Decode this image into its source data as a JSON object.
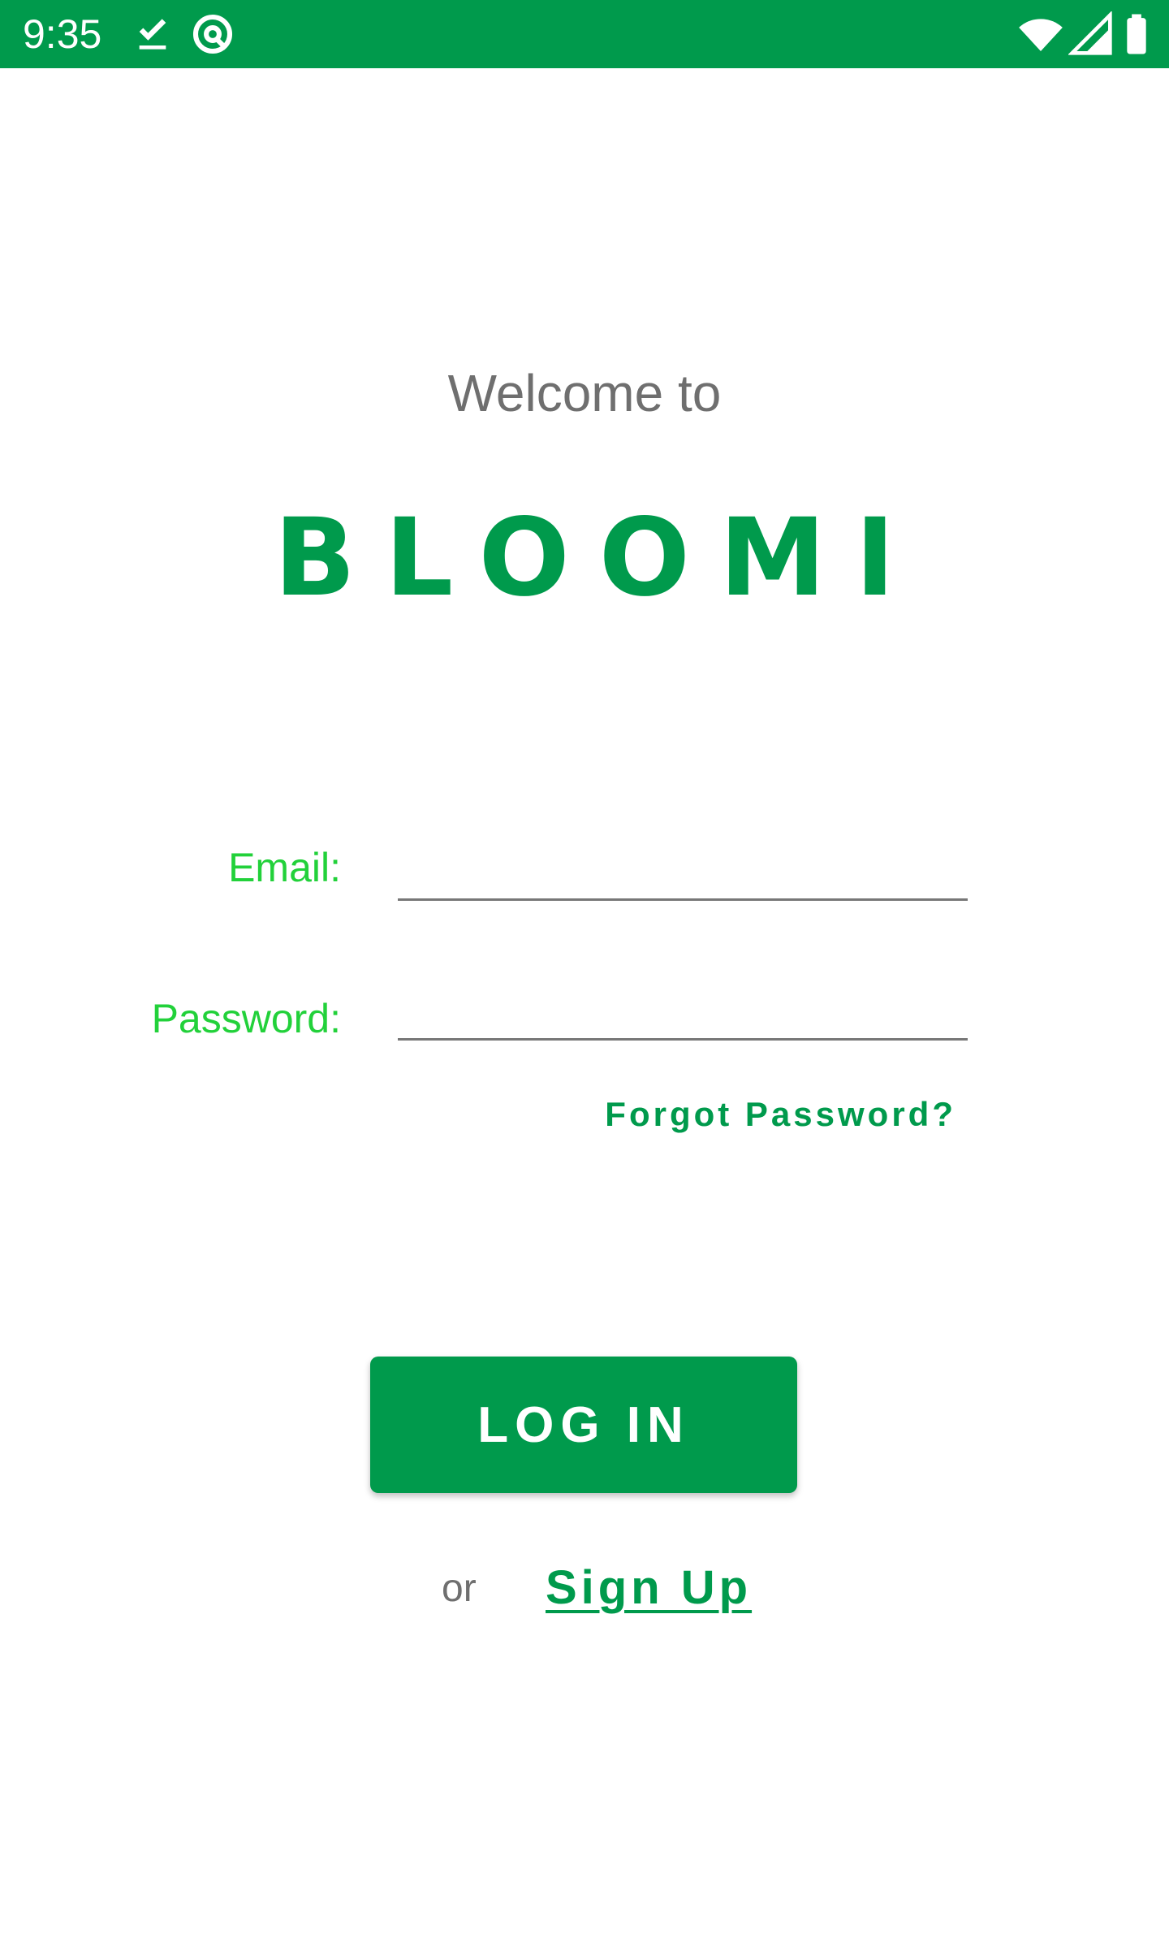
{
  "status_bar": {
    "time": "9:35",
    "icons": [
      "download-done-icon",
      "at-sign-icon",
      "wifi-icon",
      "cellular-signal-icon",
      "battery-icon"
    ],
    "background_color": "#009a4c"
  },
  "welcome": {
    "text": "Welcome to"
  },
  "brand": {
    "name": "BLOOMI",
    "color": "#009a4c"
  },
  "form": {
    "email_label": "Email:",
    "email_value": "",
    "email_placeholder": "",
    "password_label": "Password:",
    "password_value": "",
    "password_placeholder": "",
    "label_color": "#22d13a",
    "forgot_password": "Forgot Password?"
  },
  "actions": {
    "login_label": "LOG IN",
    "or_text": "or",
    "signup_label": "Sign Up",
    "accent_color": "#009a4c"
  }
}
